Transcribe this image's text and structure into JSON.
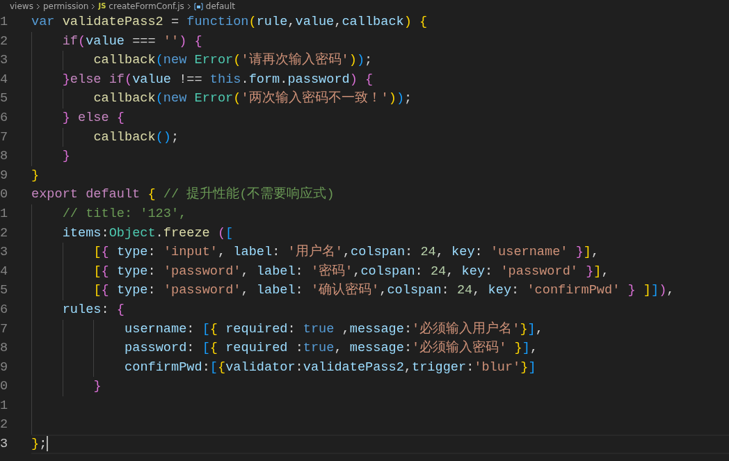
{
  "breadcrumb": {
    "items": [
      {
        "label": "views",
        "kind": "folder"
      },
      {
        "label": "permission",
        "kind": "folder"
      },
      {
        "label": "createFormConf.js",
        "kind": "file",
        "badge": "JS"
      },
      {
        "label": "default",
        "kind": "symbol"
      }
    ]
  },
  "editor": {
    "lines": [
      {
        "number": "1",
        "active": false,
        "text": "var validatePass2 = function(rule,value,callback) {"
      },
      {
        "number": "2",
        "active": false,
        "text": "    if(value === '') {"
      },
      {
        "number": "3",
        "active": false,
        "text": "        callback(new Error('请再次输入密码'));"
      },
      {
        "number": "4",
        "active": false,
        "text": "    }else if(value !== this.form.password) {"
      },
      {
        "number": "5",
        "active": false,
        "text": "        callback(new Error('两次输入密码不一致！'));"
      },
      {
        "number": "6",
        "active": false,
        "text": "    } else {"
      },
      {
        "number": "7",
        "active": false,
        "text": "        callback();"
      },
      {
        "number": "8",
        "active": false,
        "text": "    }"
      },
      {
        "number": "9",
        "active": false,
        "text": "}"
      },
      {
        "number": "0",
        "active": false,
        "text": "export default { // 提升性能(不需要响应式)"
      },
      {
        "number": "1",
        "active": false,
        "text": "    // title: '123',"
      },
      {
        "number": "2",
        "active": false,
        "text": "    items:Object.freeze (["
      },
      {
        "number": "3",
        "active": false,
        "text": "        [{ type: 'input', label: '用户名',colspan: 24, key: 'username' }],"
      },
      {
        "number": "4",
        "active": false,
        "text": "        [{ type: 'password', label: '密码',colspan: 24, key: 'password' }],"
      },
      {
        "number": "5",
        "active": false,
        "text": "        [{ type: 'password', label: '确认密码',colspan: 24, key: 'confirmPwd' } ]]),"
      },
      {
        "number": "6",
        "active": false,
        "text": "    rules: {"
      },
      {
        "number": "7",
        "active": false,
        "text": "            username: [{ required: true ,message:'必须输入用户名'}],"
      },
      {
        "number": "8",
        "active": false,
        "text": "            password: [{ required :true, message:'必须输入密码' }],"
      },
      {
        "number": "9",
        "active": false,
        "text": "            confirmPwd:[{validator:validatePass2,trigger:'blur'}]"
      },
      {
        "number": "0",
        "active": false,
        "text": "        }"
      },
      {
        "number": "1",
        "active": false
      },
      {
        "number": "2",
        "active": false
      },
      {
        "number": "3",
        "active": true,
        "text": "};"
      }
    ]
  }
}
